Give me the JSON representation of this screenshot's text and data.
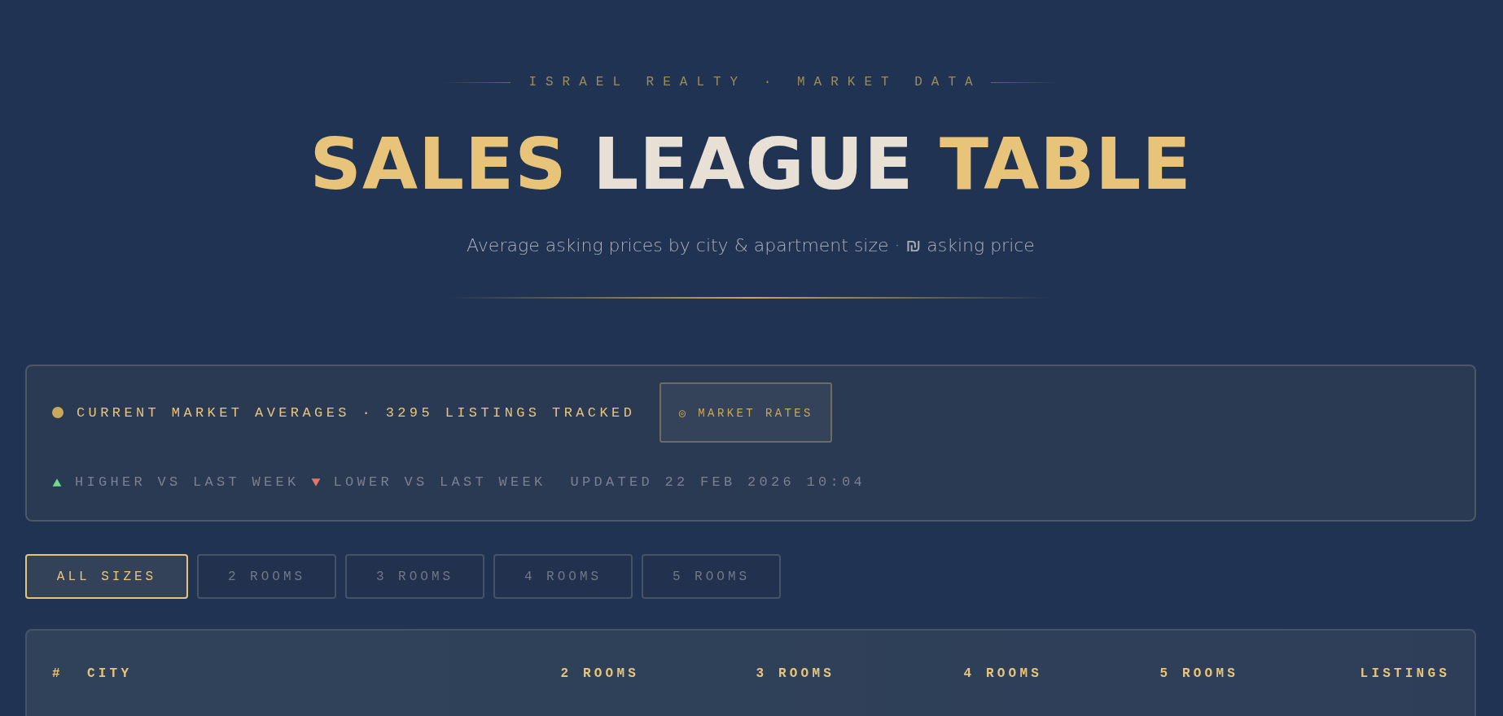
{
  "header": {
    "eyebrow": "ISRAEL REALTY · MARKET DATA",
    "title": [
      {
        "text": "SALES",
        "accent": true
      },
      {
        "text": "LEAGUE",
        "accent": false
      },
      {
        "text": "TABLE",
        "accent": true
      }
    ],
    "subtitle": "Average asking prices by city & apartment size · ₪ asking price"
  },
  "status": {
    "color": "#c9a85c",
    "text": "CURRENT MARKET AVERAGES · 3295 LISTINGS TRACKED",
    "button": "◎ MARKET RATES",
    "legend": [
      {
        "kind": "up",
        "label": "HIGHER VS LAST WEEK"
      },
      {
        "kind": "down",
        "label": "LOWER VS LAST WEEK"
      }
    ],
    "updated": "UPDATED 22 FEB 2026 10:04"
  },
  "tabs": [
    {
      "label": "ALL SIZES",
      "selected": true
    },
    {
      "label": "2 ROOMS",
      "selected": false
    },
    {
      "label": "3 ROOMS",
      "selected": false
    },
    {
      "label": "4 ROOMS",
      "selected": false
    },
    {
      "label": "5 ROOMS",
      "selected": false
    }
  ],
  "table": {
    "columns": [
      "#",
      "CITY",
      "2 ROOMS",
      "3 ROOMS",
      "4 ROOMS",
      "5 ROOMS",
      "LISTINGS"
    ]
  }
}
